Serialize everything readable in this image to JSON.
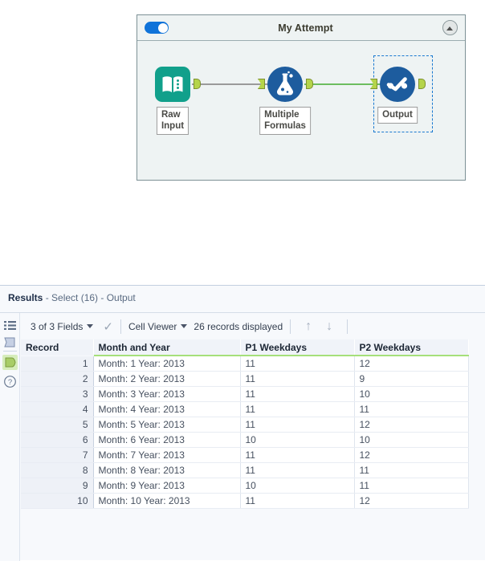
{
  "workflow": {
    "container": {
      "title": "My Attempt",
      "toggle_state": "on",
      "collapse_icon": "chevron-up-icon"
    },
    "nodes": [
      {
        "id": "raw-input",
        "label": "Raw Input",
        "icon": "book-icon",
        "color": "#11a08b"
      },
      {
        "id": "multiple-formulas",
        "label": "Multiple\nFormulas",
        "icon": "flask-icon",
        "color": "#1d5c9e"
      },
      {
        "id": "output",
        "label": "Output",
        "icon": "select-tool-icon",
        "color": "#1d5c9e",
        "selected": true
      }
    ],
    "connections": [
      {
        "from": "raw-input",
        "to": "multiple-formulas",
        "color": "#9a9a9a"
      },
      {
        "from": "multiple-formulas",
        "to": "output",
        "color": "#6dbd5f"
      }
    ]
  },
  "results": {
    "title_prefix": "Results",
    "title_suffix": " - Select (16) - Output",
    "rail_icons": [
      {
        "name": "list-view-icon",
        "active": false
      },
      {
        "name": "message-panel-icon",
        "active": false
      },
      {
        "name": "output-anchor-icon",
        "active": true
      },
      {
        "name": "help-icon",
        "active": false
      }
    ],
    "toolbar": {
      "fields_label": "3 of 3 Fields",
      "check_icon": "checkmark-icon",
      "viewer_label": "Cell Viewer",
      "records_label": "26 records displayed",
      "up_icon": "arrow-up-icon",
      "down_icon": "arrow-down-icon"
    },
    "table": {
      "columns": [
        "Record",
        "Month and Year",
        "P1 Weekdays",
        "P2 Weekdays"
      ],
      "rows": [
        [
          "1",
          "Month: 1 Year: 2013",
          "11",
          "12"
        ],
        [
          "2",
          "Month: 2 Year: 2013",
          "11",
          "9"
        ],
        [
          "3",
          "Month: 3 Year: 2013",
          "11",
          "10"
        ],
        [
          "4",
          "Month: 4 Year: 2013",
          "11",
          "11"
        ],
        [
          "5",
          "Month: 5 Year: 2013",
          "11",
          "12"
        ],
        [
          "6",
          "Month: 6 Year: 2013",
          "10",
          "10"
        ],
        [
          "7",
          "Month: 7 Year: 2013",
          "11",
          "12"
        ],
        [
          "8",
          "Month: 8 Year: 2013",
          "11",
          "11"
        ],
        [
          "9",
          "Month: 9 Year: 2013",
          "10",
          "11"
        ],
        [
          "10",
          "Month: 10 Year: 2013",
          "11",
          "12"
        ]
      ]
    }
  }
}
